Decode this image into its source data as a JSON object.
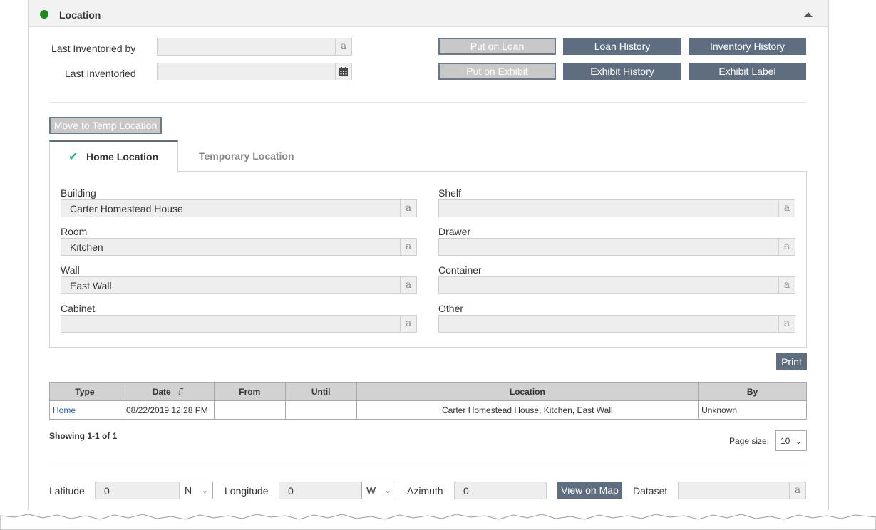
{
  "panel": {
    "title": "Location",
    "status_color": "#1e8a1e"
  },
  "inventory": {
    "last_inventoried_by_label": "Last Inventoried by",
    "last_inventoried_by_value": "",
    "last_inventoried_label": "Last Inventoried",
    "last_inventoried_value": ""
  },
  "buttons": {
    "put_on_loan": "Put on Loan",
    "loan_history": "Loan History",
    "inventory_history": "Inventory History",
    "put_on_exhibit": "Put on Exhibit",
    "exhibit_history": "Exhibit History",
    "exhibit_label": "Exhibit Label",
    "move_to_temp": "Move to Temp Location",
    "print": "Print",
    "view_on_map": "View on Map"
  },
  "tabs": {
    "home": "Home Location",
    "temporary": "Temporary Location"
  },
  "fields": {
    "building": {
      "label": "Building",
      "value": "Carter Homestead House"
    },
    "room": {
      "label": "Room",
      "value": "Kitchen"
    },
    "wall": {
      "label": "Wall",
      "value": "East Wall"
    },
    "cabinet": {
      "label": "Cabinet",
      "value": ""
    },
    "shelf": {
      "label": "Shelf",
      "value": ""
    },
    "drawer": {
      "label": "Drawer",
      "value": ""
    },
    "container": {
      "label": "Container",
      "value": ""
    },
    "other": {
      "label": "Other",
      "value": ""
    },
    "addon_glyph": "a"
  },
  "table": {
    "columns": [
      "Type",
      "Date",
      "From",
      "Until",
      "Location",
      "By"
    ],
    "rows": [
      {
        "type": "Home",
        "date": "08/22/2019 12:28 PM",
        "from": "",
        "until": "",
        "location": "Carter Homestead House, Kitchen, East Wall",
        "by": "Unknown"
      }
    ],
    "showing": "Showing 1-1 of 1",
    "page_size_label": "Page size:",
    "page_size": "10"
  },
  "geo": {
    "latitude_label": "Latitude",
    "latitude": "0",
    "lat_dir": "N",
    "longitude_label": "Longitude",
    "longitude": "0",
    "lon_dir": "W",
    "azimuth_label": "Azimuth",
    "azimuth": "0",
    "dataset_label": "Dataset",
    "dataset": ""
  },
  "colors": {
    "button_dark": "#5e6e80",
    "link": "#2a5d9f",
    "check": "#2aaa8a"
  }
}
